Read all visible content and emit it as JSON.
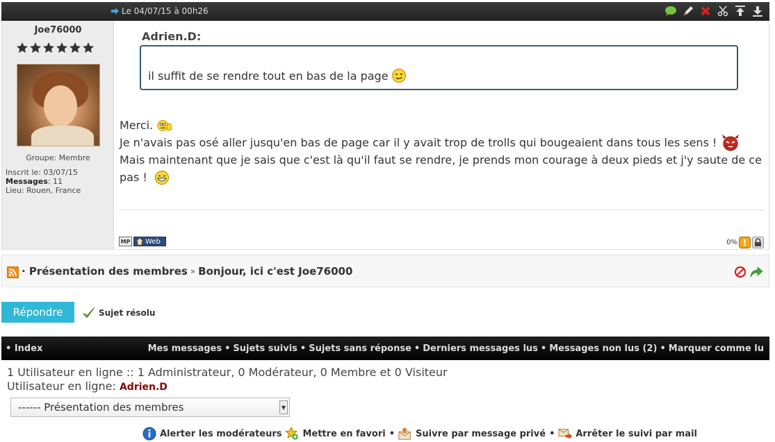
{
  "post": {
    "date": "Le 04/07/15 à 00h26"
  },
  "profile": {
    "username": "Joe76000",
    "group": "Groupe: Membre",
    "registered": "Inscrit le: 03/07/15",
    "messages_label": "Messages",
    "messages_value": ": 11",
    "location": "Lieu: Rouen, France"
  },
  "quote": {
    "author": "Adrien.D:",
    "text": "il suffit de se rendre tout en bas de la page"
  },
  "message": {
    "line1": "Merci.",
    "line2": "Je n'avais pas osé aller jusqu'en bas de page car il y avait trop de trolls qui bougeaient dans tous les sens !",
    "line3": "Mais maintenant que je sais que c'est là qu'il faut se rendre, je prends mon courage à deux pieds et j'y saute de ce",
    "line4": "pas !"
  },
  "post_footer": {
    "mp_label": "MP",
    "web_label": "Web",
    "percent": "0%"
  },
  "topic": {
    "forum": "· Présentation des membres",
    "separator": "»",
    "title": "Bonjour, ici c'est Joe76000"
  },
  "reply": {
    "button_label": "Répondre",
    "solved_label": "Sujet résolu"
  },
  "nav": {
    "index": "• Index",
    "links": [
      "Mes messages",
      "Sujets suivis",
      "Sujets sans réponse",
      "Derniers messages lus",
      "Messages non lus (2)",
      "Marquer comme lu"
    ]
  },
  "online": {
    "summary": "1 Utilisateur en ligne :: 1 Administrateur, 0 Modérateur, 0 Membre et 0 Visiteur",
    "label": "Utilisateur en ligne: ",
    "user": "Adrien.D"
  },
  "forum_select": {
    "selected": "------ Présentation des membres"
  },
  "bottom_actions": {
    "alert": "Alerter les modérateurs",
    "favorite": "Mettre en favori",
    "follow_pm": "Suivre par message privé",
    "stop_mail": "Arrêter le suivi par mail"
  },
  "colors": {
    "reply_button": "#2fb8d8",
    "admin_name": "#8b0000",
    "quote_border": "#3a5a74"
  }
}
